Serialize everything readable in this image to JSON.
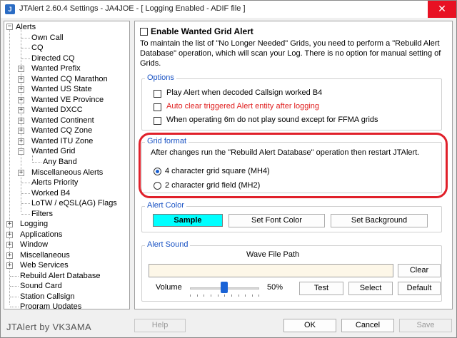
{
  "window": {
    "title": "JTAlert 2.60.4 Settings  -  JA4JOE  -  [ Logging Enabled - ADIF file ]",
    "close_glyph": "✕",
    "app_icon_glyph": "J"
  },
  "tree": {
    "items": [
      {
        "label": "Alerts",
        "expander": "−"
      },
      {
        "label": "Own Call"
      },
      {
        "label": "CQ"
      },
      {
        "label": "Directed CQ"
      },
      {
        "label": "Wanted Prefix",
        "expander": "+"
      },
      {
        "label": "Wanted CQ Marathon",
        "expander": "+"
      },
      {
        "label": "Wanted US State",
        "expander": "+"
      },
      {
        "label": "Wanted VE Province",
        "expander": "+"
      },
      {
        "label": "Wanted DXCC",
        "expander": "+"
      },
      {
        "label": "Wanted Continent",
        "expander": "+"
      },
      {
        "label": "Wanted CQ Zone",
        "expander": "+"
      },
      {
        "label": "Wanted ITU Zone",
        "expander": "+"
      },
      {
        "label": "Wanted Grid",
        "expander": "−"
      },
      {
        "label": "Any Band"
      },
      {
        "label": "Miscellaneous Alerts",
        "expander": "+"
      },
      {
        "label": "Alerts Priority"
      },
      {
        "label": "Worked B4"
      },
      {
        "label": "LoTW / eQSL(AG) Flags"
      },
      {
        "label": "Filters"
      },
      {
        "label": "Logging",
        "expander": "+"
      },
      {
        "label": "Applications",
        "expander": "+"
      },
      {
        "label": "Window",
        "expander": "+"
      },
      {
        "label": "Miscellaneous",
        "expander": "+"
      },
      {
        "label": "Web Services",
        "expander": "+"
      },
      {
        "label": "Rebuild Alert Database"
      },
      {
        "label": "Sound Card"
      },
      {
        "label": "Station Callsign"
      },
      {
        "label": "Program Updates"
      }
    ]
  },
  "panel": {
    "enable_label": "Enable Wanted Grid Alert",
    "description": "To maintain the list of \"No Longer Needed\" Grids, you need to perform a \"Rebuild Alert Database\" operation, which will scan your Log. There is no option for manual setting of Grids.",
    "options": {
      "title": "Options",
      "items": [
        {
          "label": "Play Alert when decoded Callsign worked B4",
          "checked": false,
          "color": "#000000"
        },
        {
          "label": "Auto clear triggered Alert entity after logging",
          "checked": false,
          "color": "#e02020"
        },
        {
          "label": "When operating 6m do not play sound except for FFMA grids",
          "checked": false,
          "color": "#000000"
        }
      ]
    },
    "grid_format": {
      "title": "Grid format",
      "note": "After changes run the \"Rebuild Alert Database\" operation then restart JTAlert.",
      "options": [
        {
          "label": "4 character grid square (MH4)",
          "selected": true
        },
        {
          "label": "2 character grid field (MH2)",
          "selected": false
        }
      ]
    },
    "alert_color": {
      "title": "Alert Color",
      "sample_label": "Sample",
      "sample_color": "#00ffff",
      "font_button": "Set Font Color",
      "background_button": "Set Background"
    },
    "alert_sound": {
      "title": "Alert Sound",
      "wave_header": "Wave File Path",
      "wave_value": "",
      "clear_button": "Clear",
      "volume_label": "Volume",
      "volume_value": "50%",
      "volume_level": 0.5,
      "test_button": "Test",
      "select_button": "Select",
      "default_button": "Default"
    }
  },
  "footer": {
    "brand": "JTAlert by VK3AMA",
    "help_button": "Help",
    "ok_button": "OK",
    "cancel_button": "Cancel",
    "save_button": "Save"
  },
  "colors": {
    "group_title": "#1a53c4",
    "highlight_oval": "#e0202a",
    "accent": "#1a63d6"
  }
}
